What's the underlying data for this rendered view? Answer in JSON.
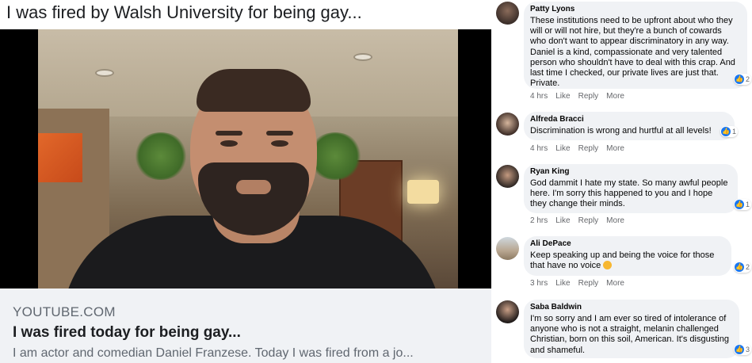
{
  "post": {
    "video_title": "I was fired by Walsh University for being gay...",
    "link_domain": "YOUTUBE.COM",
    "link_title": "I was fired today for being gay...",
    "link_description": "I am actor and comedian Daniel Franzese. Today I was fired from a jo..."
  },
  "comments": [
    {
      "author": "Patty Lyons",
      "text": "These institutions need to be upfront about who they will or will not hire, but they're a bunch of cowards who don't want to appear discriminatory in any way. Daniel is a kind, compassionate and very talented person who shouldn't have to deal with this crap. And last time I checked, our private lives are just that. Private.",
      "reaction_icon": "like-icon",
      "reaction_count": "2",
      "time": "4 hrs",
      "like": "Like",
      "reply": "Reply",
      "more": "More"
    },
    {
      "author": "Alfreda Bracci",
      "text": "Discrimination is wrong and hurtful at all levels!",
      "reaction_icon": "like-icon",
      "reaction_count": "1",
      "time": "4 hrs",
      "like": "Like",
      "reply": "Reply",
      "more": "More"
    },
    {
      "author": "Ryan King",
      "text": "God dammit I hate my state. So many awful people here. I'm sorry this happened to you and I hope they change their minds.",
      "reaction_icon": "like-icon",
      "reaction_count": "1",
      "time": "2 hrs",
      "like": "Like",
      "reply": "Reply",
      "more": "More"
    },
    {
      "author": "Ali DePace",
      "text": "Keep speaking up and being the voice for those that have no voice",
      "emoji": "heart-eyes-emoji",
      "reaction_icon": "like-icon",
      "reaction_count": "2",
      "time": "3 hrs",
      "like": "Like",
      "reply": "Reply",
      "more": "More"
    },
    {
      "author": "Saba Baldwin",
      "text": "I'm so sorry and I am ever so tired of intolerance of anyone who is not a straight, melanin challenged Christian, born on this soil, American. It's disgusting and shameful.",
      "reaction_icon": "like-icon",
      "reaction_count": "3"
    }
  ],
  "colors": {
    "bubble": "#f0f2f5",
    "like_blue": "#1877f2",
    "meta_gray": "#65676b"
  }
}
